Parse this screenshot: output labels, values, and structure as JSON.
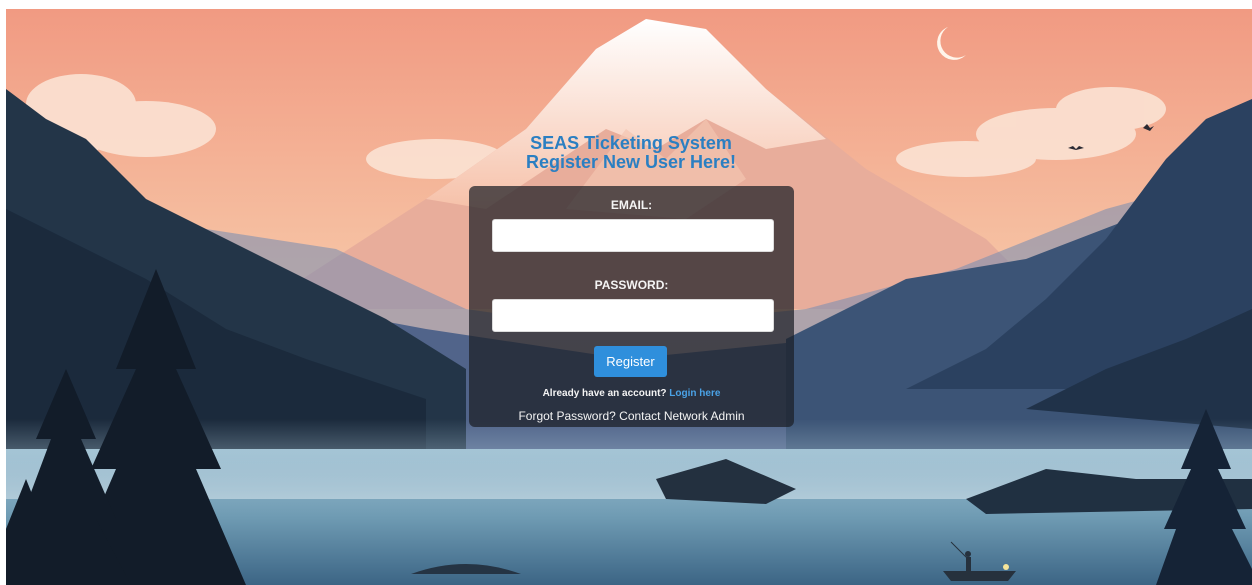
{
  "header": {
    "title": "SEAS Ticketing System",
    "subtitle": "Register New User Here!"
  },
  "form": {
    "email_label": "EMAIL:",
    "email_value": "",
    "password_label": "PASSWORD:",
    "password_value": "",
    "register_label": "Register"
  },
  "footer": {
    "account_prompt": "Already have an account?",
    "login_link": "Login here",
    "forgot_text": "Forgot Password? Contact Network Admin"
  },
  "colors": {
    "heading": "#2b7fc2",
    "button": "#2f8fdc",
    "link": "#4aa2e6",
    "panel": "#1c1e26"
  },
  "background": {
    "icon": "mountain-lake-scene"
  }
}
